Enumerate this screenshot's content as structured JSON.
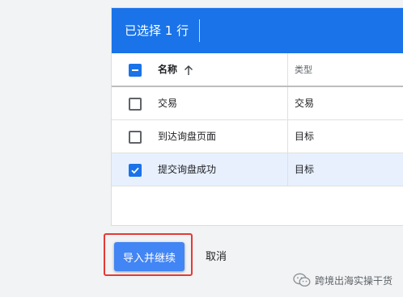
{
  "selection_bar": {
    "label": "已选择 1 行",
    "color": "#1a73e8"
  },
  "table": {
    "columns": [
      {
        "label": "名称",
        "sort_icon": "arrow-up-icon"
      },
      {
        "label": "类型"
      }
    ],
    "rows": [
      {
        "name": "交易",
        "type": "交易",
        "checked": false
      },
      {
        "name": "到达询盘页面",
        "type": "目标",
        "checked": false
      },
      {
        "name": "提交询盘成功",
        "type": "目标",
        "checked": true
      }
    ],
    "header_checkbox_state": "indeterminate"
  },
  "actions": {
    "primary_label": "导入并继续",
    "cancel_label": "取消"
  },
  "watermark": {
    "text": "跨境出海实操干货",
    "icon": "wechat-icon"
  },
  "colors": {
    "accent": "#1a73e8",
    "primary_button": "#4285f4",
    "selected_row": "#e8f0fe",
    "highlight_border": "#e53935"
  }
}
